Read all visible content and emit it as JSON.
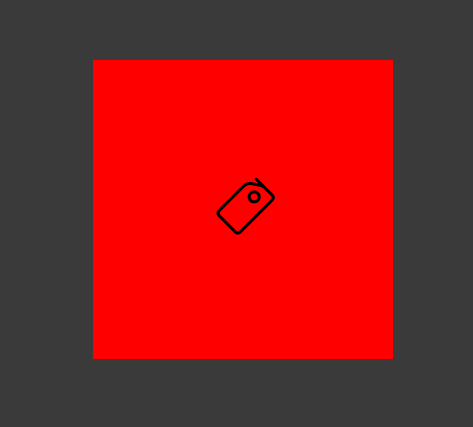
{
  "tile": {
    "background_color": "#ff0000",
    "icon": "tag-icon",
    "icon_color": "#000000"
  },
  "page": {
    "background_color": "#3a3a3a"
  }
}
